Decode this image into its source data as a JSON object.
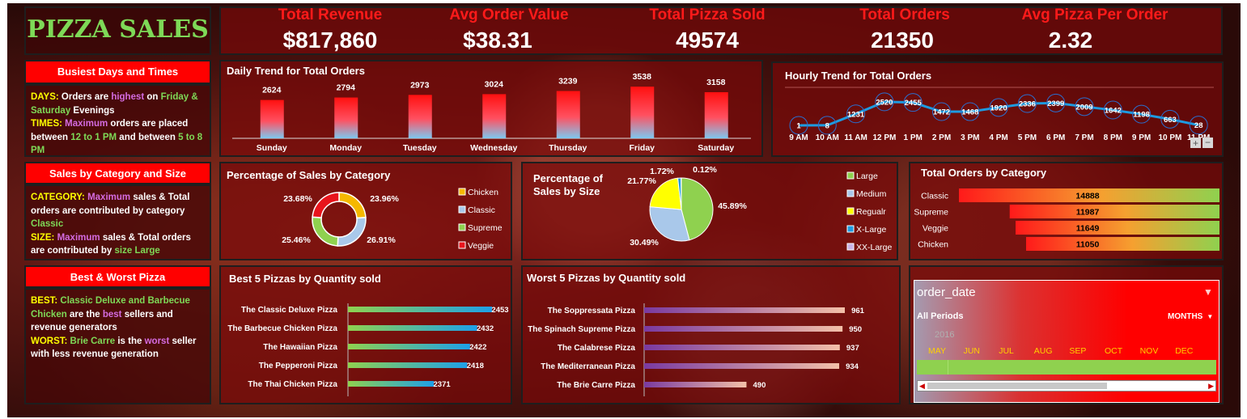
{
  "title": "PIZZA SALES",
  "kpis": [
    {
      "label": "Total Revenue",
      "value": "$817,860"
    },
    {
      "label": "Avg Order Value",
      "value": "$38.31"
    },
    {
      "label": "Total Pizza Sold",
      "value": "49574"
    },
    {
      "label": "Total Orders",
      "value": "21350"
    },
    {
      "label": "Avg Pizza Per Order",
      "value": "2.32"
    }
  ],
  "side": {
    "busiest_title": "Busiest Days and Times",
    "days_key": "DAYS:",
    "days_t1": " Orders are ",
    "days_hl": "highest",
    "days_t2": " on ",
    "days_days": "Friday & Saturday",
    "days_t3": " Evenings",
    "times_key": "TIMES:",
    "times_hl": " Maximum",
    "times_t1": " orders are placed between ",
    "times_r1": "12 to 1 PM",
    "times_t2": " and between ",
    "times_r2": "5 to 8 PM",
    "cat_title": "Sales by Category and Size",
    "cat_key": "CATEGORY:",
    "cat_hl": " Maximum",
    "cat_t1": " sales & Total orders are contributed by  category ",
    "cat_val": "Classic",
    "size_key": " SIZE:",
    "size_hl": " Maximum",
    "size_t1": " sales & Total orders are contributed by  ",
    "size_val": "size Large",
    "bw_title": "Best & Worst Pizza",
    "best_key": "BEST:",
    "best_val": "  Classic Deluxe and Barbecue Chicken",
    "best_t1": " are the ",
    "best_hl": "best",
    "best_t2": " sellers and revenue generators",
    "worst_key": "WORST:",
    "worst_val": " Brie Carre",
    "worst_t1": " is the ",
    "worst_hl": "worst",
    "worst_t2": " seller with less revenue generation"
  },
  "slicer": {
    "field": "order_date",
    "period": "All Periods",
    "unit": "MONTHS",
    "year": "2016",
    "months": [
      "MAY",
      "JUN",
      "JUL",
      "AUG",
      "SEP",
      "OCT",
      "NOV",
      "DEC"
    ]
  },
  "colors": {
    "accent": "#ff0000",
    "kpi_label": "#ff1a1a",
    "title_green": "#7ed957",
    "line": "#1e9be0"
  },
  "chart_data": [
    {
      "id": "daily",
      "type": "bar",
      "title": "Daily Trend for Total Orders",
      "categories": [
        "Sunday",
        "Monday",
        "Tuesday",
        "Wednesday",
        "Thursday",
        "Friday",
        "Saturday"
      ],
      "values": [
        2624,
        2794,
        2973,
        3024,
        3239,
        3538,
        3158
      ]
    },
    {
      "id": "hourly",
      "type": "line",
      "title": "Hourly Trend for Total Orders",
      "categories": [
        "9 AM",
        "10 AM",
        "11 AM",
        "12 PM",
        "1 PM",
        "2 PM",
        "3 PM",
        "4 PM",
        "5 PM",
        "6 PM",
        "7 PM",
        "8 PM",
        "9 PM",
        "10 PM",
        "11 PM"
      ],
      "values": [
        1,
        8,
        1231,
        2520,
        2455,
        1472,
        1468,
        1920,
        2336,
        2399,
        2009,
        1642,
        1198,
        663,
        28
      ]
    },
    {
      "id": "cat_pct",
      "type": "pie",
      "title": "Percentage of Sales by Category",
      "labels": [
        "Chicken",
        "Classic",
        "Supreme",
        "Veggie"
      ],
      "values": [
        23.96,
        26.91,
        25.46,
        23.68
      ],
      "value_labels": [
        "23.96%",
        "26.91%",
        "25.46%",
        "23.68%"
      ],
      "colors": [
        "#f5b800",
        "#a9c8ea",
        "#8fd14f",
        "#e8141c"
      ]
    },
    {
      "id": "size_pct",
      "type": "pie",
      "title": "Percentage of Sales by Size",
      "labels": [
        "Large",
        "Medium",
        "Regualr",
        "X-Large",
        "XX-Large"
      ],
      "values": [
        45.89,
        30.49,
        21.77,
        1.72,
        0.12
      ],
      "value_labels": [
        "45.89%",
        "30.49%",
        "21.77%",
        "1.72%",
        "0.12%"
      ],
      "colors": [
        "#8fd14f",
        "#a9c8ea",
        "#ffff00",
        "#1e9be0",
        "#c9b5e8"
      ]
    },
    {
      "id": "cat_orders",
      "type": "bar",
      "title": "Total Orders by Category",
      "categories": [
        "Classic",
        "Supreme",
        "Veggie",
        "Chicken"
      ],
      "values": [
        14888,
        11987,
        11649,
        11050
      ]
    },
    {
      "id": "best5",
      "type": "bar",
      "title": "Best 5 Pizzas by Quantity sold",
      "categories": [
        "The Classic Deluxe Pizza",
        "The Barbecue Chicken Pizza",
        "The Hawaiian Pizza",
        "The Pepperoni Pizza",
        "The Thai Chicken Pizza"
      ],
      "values": [
        2453,
        2432,
        2422,
        2418,
        2371
      ]
    },
    {
      "id": "worst5",
      "type": "bar",
      "title": "Worst 5 Pizzas by Quantity sold",
      "categories": [
        "The Soppressata Pizza",
        "The Spinach Supreme Pizza",
        "The Calabrese Pizza",
        "The Mediterranean Pizza",
        "The Brie Carre Pizza"
      ],
      "values": [
        961,
        950,
        937,
        934,
        490
      ]
    }
  ]
}
